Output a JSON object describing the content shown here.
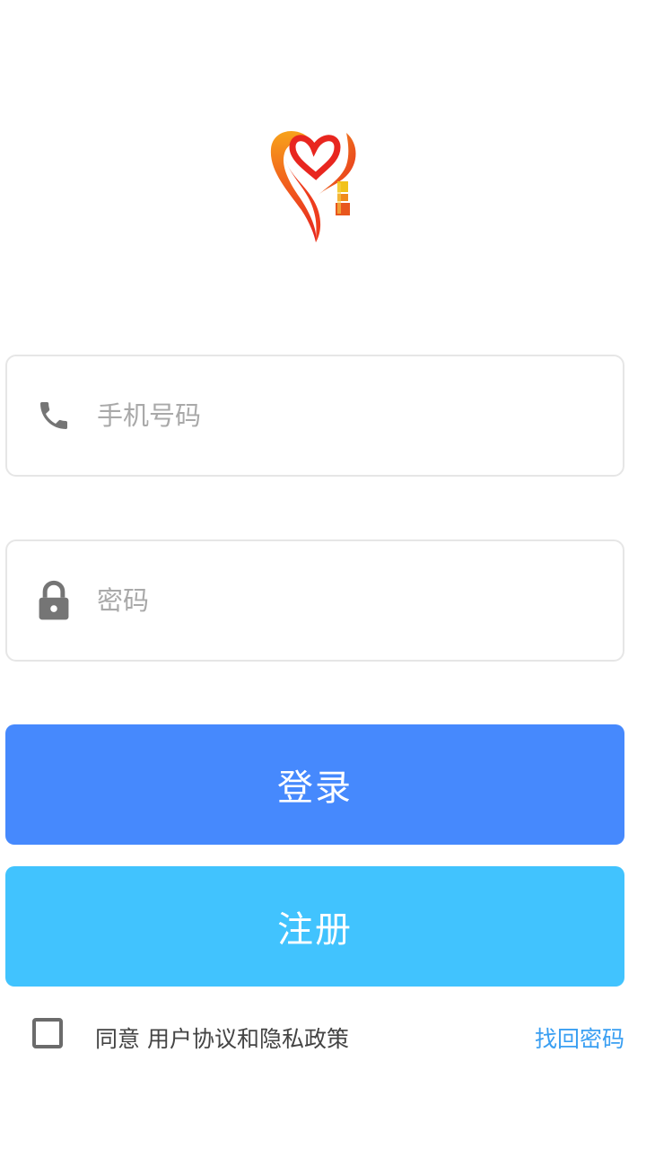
{
  "login_form": {
    "phone_placeholder": "手机号码",
    "phone_icon": "phone-icon",
    "password_placeholder": "密码",
    "password_icon": "lock-icon"
  },
  "buttons": {
    "login_label": "登录",
    "register_label": "注册"
  },
  "agreement": {
    "checked": false,
    "text": "同意 用户协议和隐私政策"
  },
  "links": {
    "forgot_password": "找回密码"
  },
  "colors": {
    "login_button": "#4689fd",
    "register_button": "#41c3fe",
    "link": "#3a9ff2"
  }
}
